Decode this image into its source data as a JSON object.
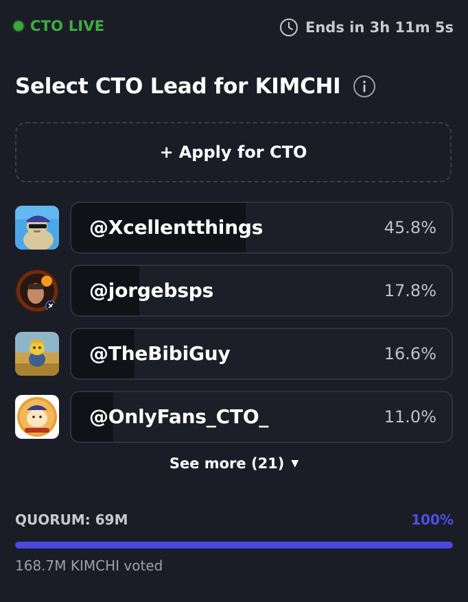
{
  "status": {
    "label": "CTO LIVE",
    "color": "#3aa93a"
  },
  "timer": {
    "label": "Ends in 3h 11m 5s",
    "icon": "clock-icon"
  },
  "title": {
    "text": "Select CTO Lead for KIMCHI",
    "icon": "info-icon"
  },
  "apply": {
    "plus": "+",
    "label": "Apply for CTO"
  },
  "candidates": [
    {
      "handle": "@Xcellentthings",
      "percent_label": "45.8%",
      "percent": 45.8
    },
    {
      "handle": "@jorgebsps",
      "percent_label": "17.8%",
      "percent": 17.8
    },
    {
      "handle": "@TheBibiGuy",
      "percent_label": "16.6%",
      "percent": 16.6
    },
    {
      "handle": "@OnlyFans_CTO_",
      "percent_label": "11.0%",
      "percent": 11.0
    }
  ],
  "see_more": {
    "label": "See more (21)",
    "icon": "caret-down-icon"
  },
  "quorum": {
    "label": "QUORUM: 69M",
    "percent_label": "100%",
    "progress": 100,
    "voted_label": "168.7M KIMCHI voted",
    "accent": "#4b47e0"
  }
}
